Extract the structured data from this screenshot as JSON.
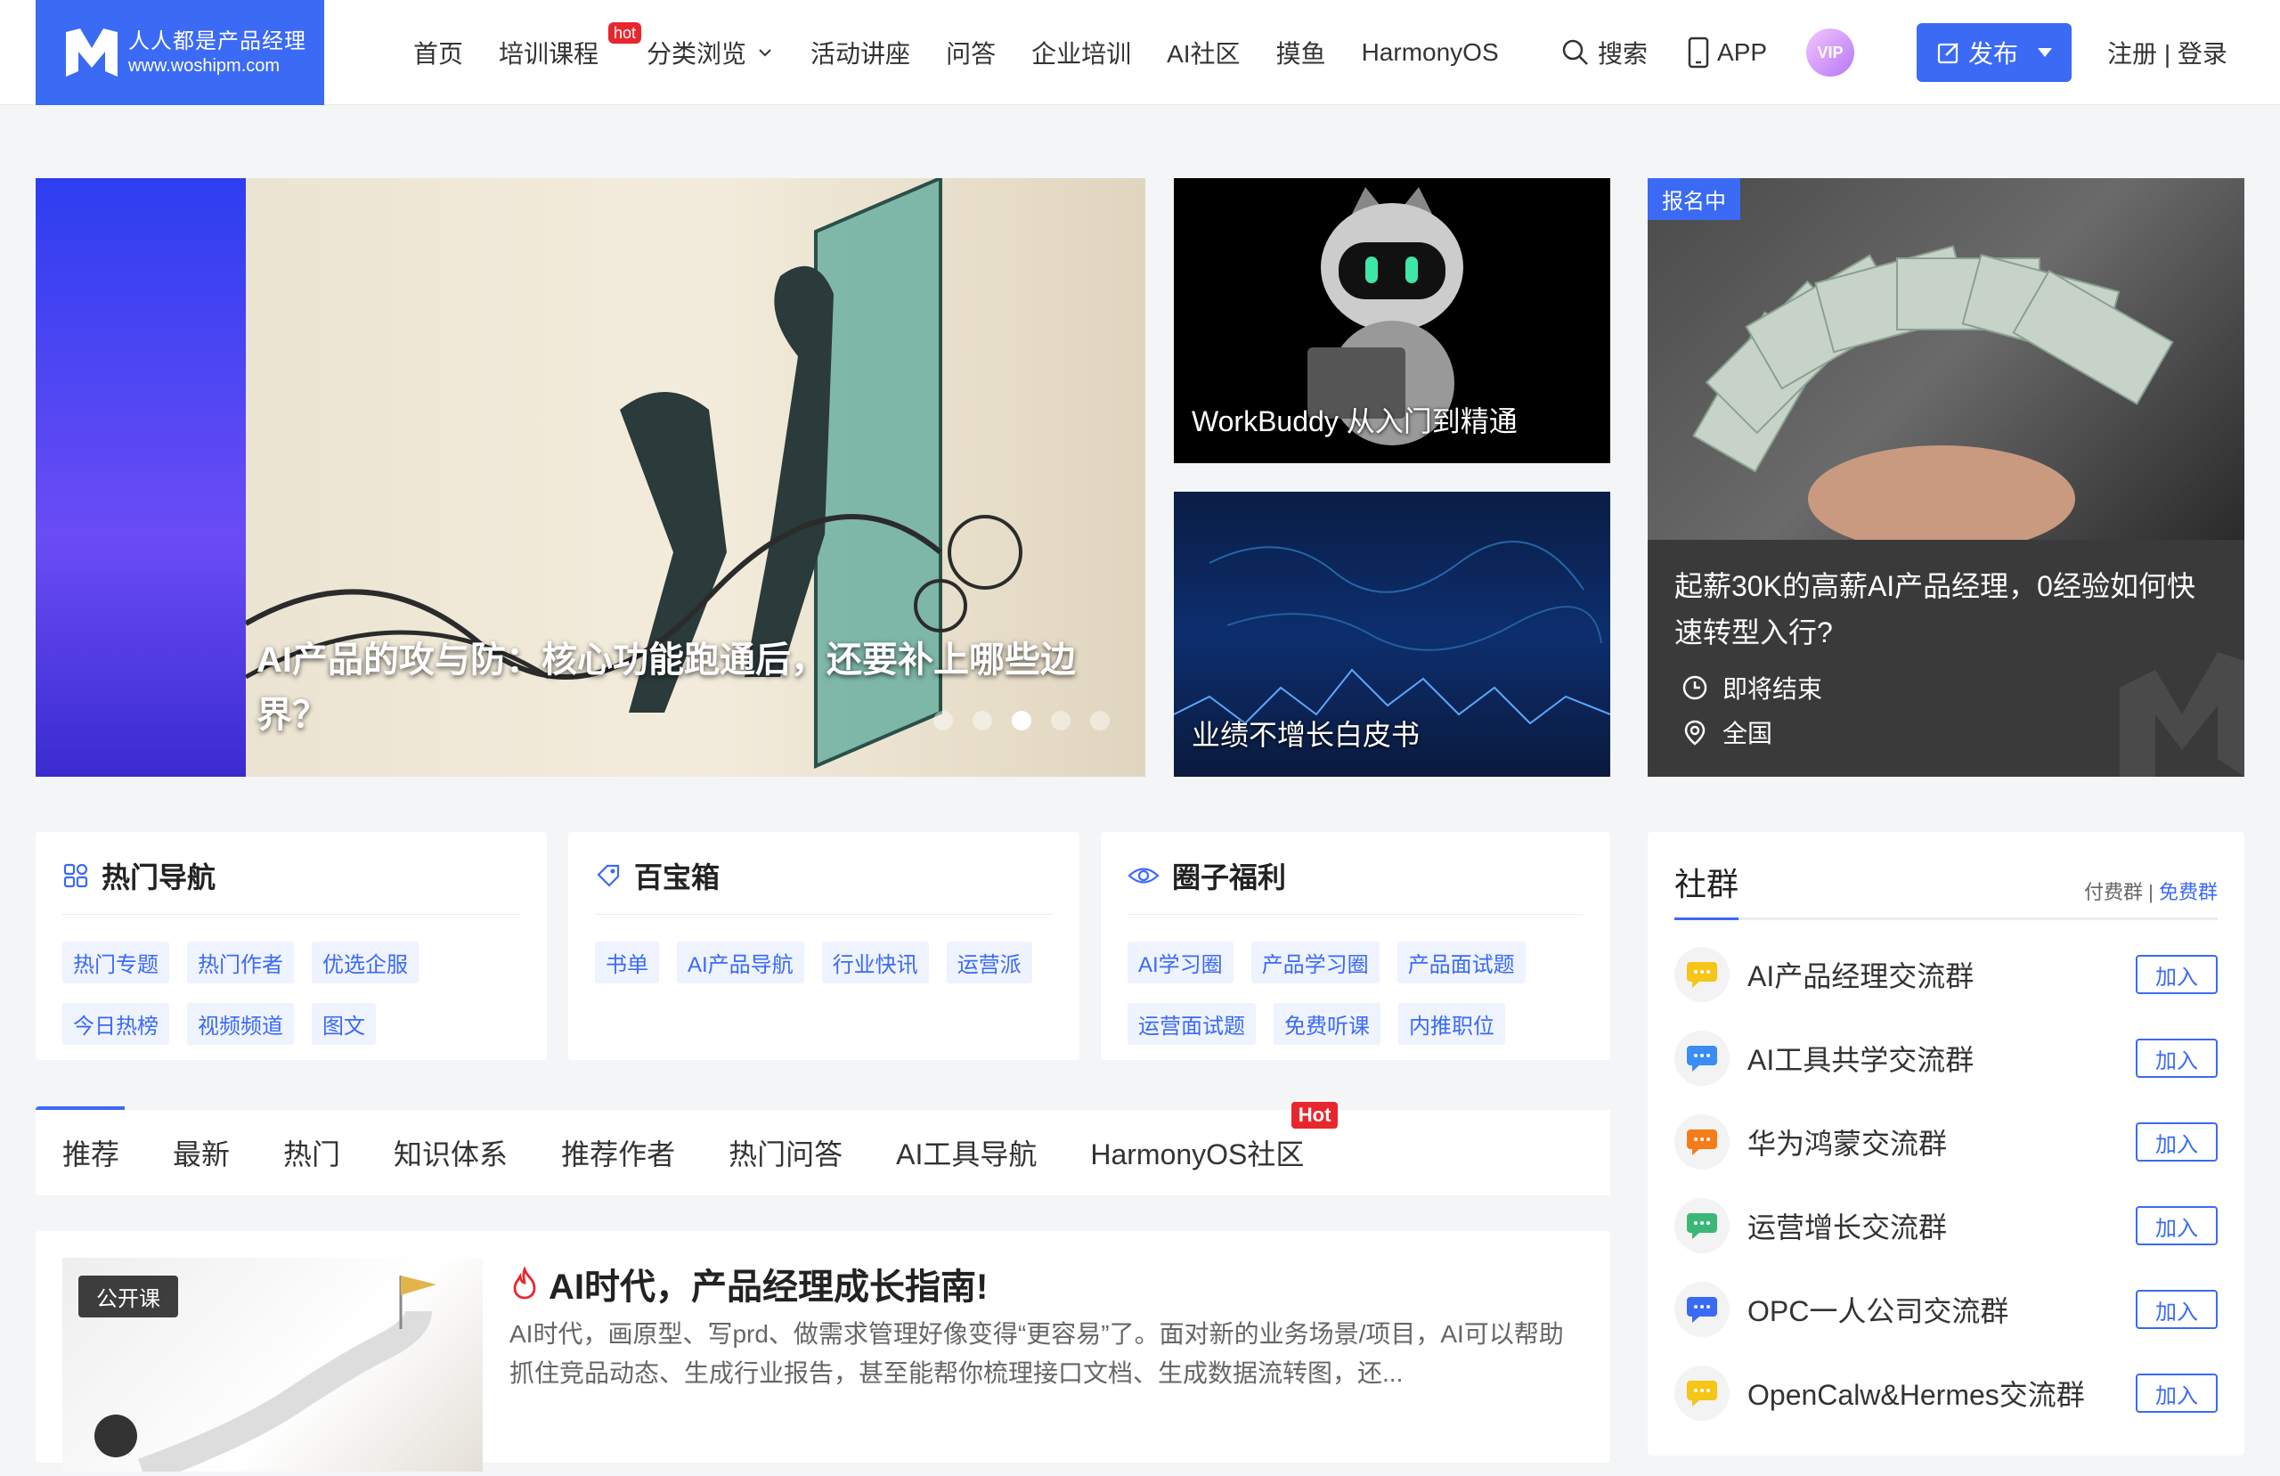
{
  "logo": {
    "cn": "人人都是产品经理",
    "en": "www.woshipm.com"
  },
  "nav": {
    "items": [
      "首页",
      "培训课程",
      "分类浏览",
      "活动讲座",
      "问答",
      "企业培训",
      "AI社区",
      "摸鱼",
      "HarmonyOS"
    ],
    "hot_badge": "hot"
  },
  "tools": {
    "search": "搜索",
    "app": "APP",
    "vip": "VIP",
    "publish": "发布",
    "auth": "注册 | 登录"
  },
  "hero": {
    "title": "AI产品的攻与防：核心功能跑通后，还要补上哪些边界？",
    "active_dot": 3,
    "dot_count": 5
  },
  "cards": [
    {
      "title": "WorkBuddy 从入门到精通"
    },
    {
      "title": "业绩不增长白皮书"
    }
  ],
  "event": {
    "badge": "报名中",
    "title": "起薪30K的高薪AI产品经理，0经验如何快速转型入行?",
    "time": "即将结束",
    "location": "全国"
  },
  "boxes": [
    {
      "title": "热门导航",
      "tags": [
        "热门专题",
        "热门作者",
        "优选企服",
        "今日热榜",
        "视频频道",
        "图文"
      ]
    },
    {
      "title": "百宝箱",
      "tags": [
        "书单",
        "AI产品导航",
        "行业快讯",
        "运营派"
      ]
    },
    {
      "title": "圈子福利",
      "tags": [
        "AI学习圈",
        "产品学习圈",
        "产品面试题",
        "运营面试题",
        "免费听课",
        "内推职位"
      ]
    }
  ],
  "tabs": {
    "items": [
      "推荐",
      "最新",
      "热门",
      "知识体系",
      "推荐作者",
      "热门问答",
      "AI工具导航",
      "HarmonyOS社区"
    ],
    "hot": "Hot"
  },
  "article": {
    "badge": "公开课",
    "title": "AI时代，产品经理成长指南!",
    "desc": "AI时代，画原型、写prd、做需求管理好像变得“更容易”了。面对新的业务场景/项目，AI可以帮助抓住竞品动态、生成行业报告，甚至能帮你梳理接口文档、生成数据流转图，还..."
  },
  "community": {
    "title": "社群",
    "paid": "付费群",
    "sep": " | ",
    "free": "免费群",
    "join_label": "加入",
    "groups": [
      {
        "name": "AI产品经理交流群",
        "color": "#f5c518"
      },
      {
        "name": "AI工具共学交流群",
        "color": "#3b8cf5"
      },
      {
        "name": "华为鸿蒙交流群",
        "color": "#f57c1a"
      },
      {
        "name": "运营增长交流群",
        "color": "#3cb77a"
      },
      {
        "name": "OPC一人公司交流群",
        "color": "#3b6af5"
      },
      {
        "name": "OpenCalw&Hermes交流群",
        "color": "#f5c518"
      }
    ]
  }
}
